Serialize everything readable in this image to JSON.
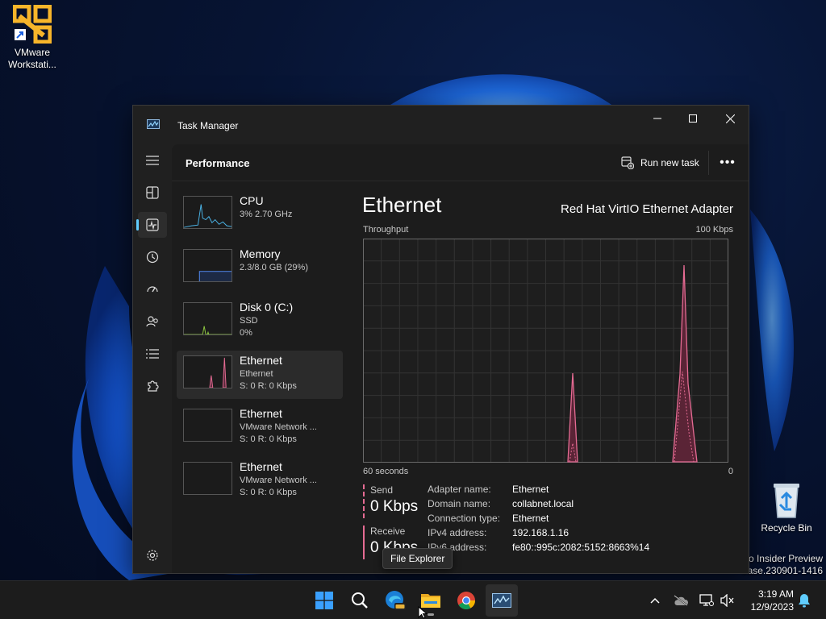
{
  "desktop": {
    "vmware_label": "VMware\nWorkstati...",
    "recycle_label": "Recycle Bin",
    "watermark_line1": "ro Insider Preview",
    "watermark_line2": "ease.230901-1416"
  },
  "window": {
    "title": "Task Manager",
    "minimize": "—",
    "maximize": "☐",
    "close": "✕"
  },
  "header": {
    "title": "Performance",
    "run_new_task": "Run new task",
    "more": "•••"
  },
  "devices": [
    {
      "name": "CPU",
      "line1": "3% 2.70 GHz",
      "line2": ""
    },
    {
      "name": "Memory",
      "line1": "2.3/8.0 GB (29%)",
      "line2": ""
    },
    {
      "name": "Disk 0 (C:)",
      "line1": "SSD",
      "line2": "0%"
    },
    {
      "name": "Ethernet",
      "line1": "Ethernet",
      "line2": "S: 0 R: 0 Kbps"
    },
    {
      "name": "Ethernet",
      "line1": "VMware Network ...",
      "line2": "S: 0 R: 0 Kbps"
    },
    {
      "name": "Ethernet",
      "line1": "VMware Network ...",
      "line2": "S: 0 R: 0 Kbps"
    }
  ],
  "detail": {
    "title": "Ethernet",
    "adapter": "Red Hat VirtIO Ethernet Adapter",
    "throughput_label": "Throughput",
    "max_label": "100 Kbps",
    "time_label": "60 seconds",
    "zero_label": "0",
    "send_label": "Send",
    "send_value": "0 Kbps",
    "receive_label": "Receive",
    "receive_value": "0 Kbps",
    "properties": [
      {
        "key": "Adapter name:",
        "value": "Ethernet"
      },
      {
        "key": "Domain name:",
        "value": "collabnet.local"
      },
      {
        "key": "Connection type:",
        "value": "Ethernet"
      },
      {
        "key": "IPv4 address:",
        "value": "192.168.1.16"
      },
      {
        "key": "IPv6 address:",
        "value": "fe80::995c:2082:5152:8663%14"
      }
    ]
  },
  "tooltip": "File Explorer",
  "clock": {
    "time": "3:19 AM",
    "date": "12/9/2023"
  },
  "colors": {
    "accent": "#60cdff",
    "ethernet": "#e56b93",
    "cpu": "#4ab3e6",
    "memory": "#4a7bd6",
    "disk": "#8cc63f"
  }
}
